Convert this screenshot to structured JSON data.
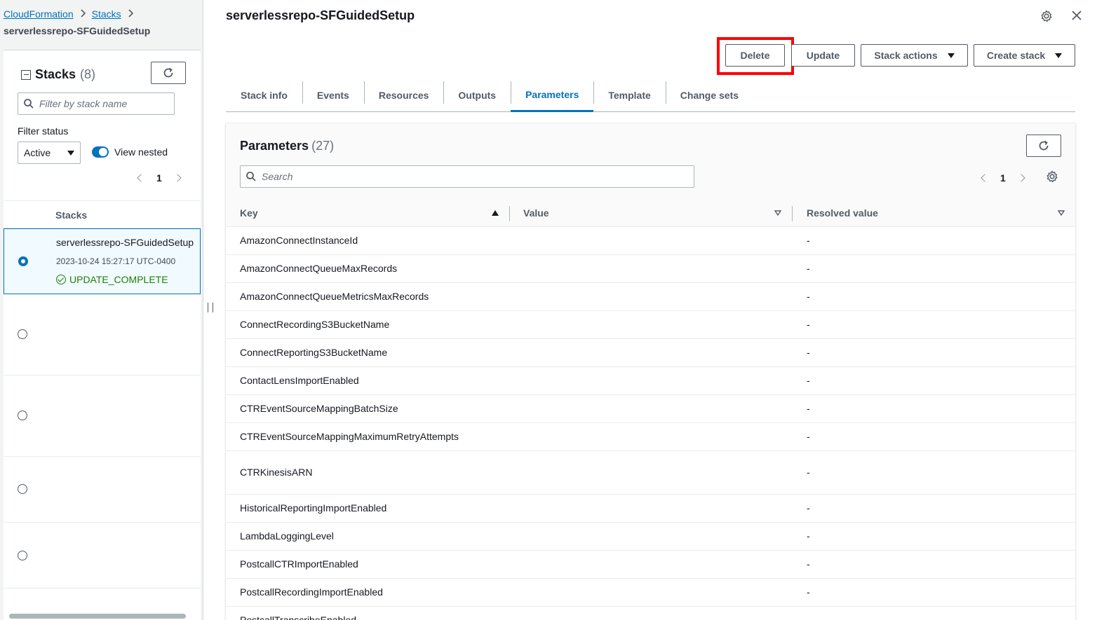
{
  "breadcrumb": {
    "items": [
      "CloudFormation",
      "Stacks"
    ],
    "current": "serverlessrepo-SFGuidedSetup"
  },
  "left_panel": {
    "title": "Stacks",
    "count": "(8)",
    "search_placeholder": "Filter by stack name",
    "filter_status_label": "Filter status",
    "status_value": "Active",
    "view_nested_label": "View nested",
    "view_nested_on": true,
    "page": "1",
    "column_header": "Stacks",
    "selected_stack": {
      "name": "serverlessrepo-SFGuidedSetup",
      "timestamp": "2023-10-24 15:27:17 UTC-0400",
      "status": "UPDATE_COMPLETE"
    }
  },
  "main": {
    "title": "serverlessrepo-SFGuidedSetup",
    "buttons": {
      "delete": "Delete",
      "update": "Update",
      "stack_actions": "Stack actions",
      "create_stack": "Create stack"
    },
    "tabs": [
      "Stack info",
      "Events",
      "Resources",
      "Outputs",
      "Parameters",
      "Template",
      "Change sets"
    ],
    "active_tab": "Parameters",
    "parameters": {
      "title": "Parameters",
      "count": "(27)",
      "search_placeholder": "Search",
      "page": "1",
      "columns": [
        "Key",
        "Value",
        "Resolved value"
      ],
      "rows": [
        {
          "key": "AmazonConnectInstanceId",
          "resolved": "-"
        },
        {
          "key": "AmazonConnectQueueMaxRecords",
          "resolved": "-"
        },
        {
          "key": "AmazonConnectQueueMetricsMaxRecords",
          "resolved": "-"
        },
        {
          "key": "ConnectRecordingS3BucketName",
          "resolved": "-"
        },
        {
          "key": "ConnectReportingS3BucketName",
          "resolved": "-"
        },
        {
          "key": "ContactLensImportEnabled",
          "resolved": "-"
        },
        {
          "key": "CTREventSourceMappingBatchSize",
          "resolved": "-"
        },
        {
          "key": "CTREventSourceMappingMaximumRetryAttempts",
          "resolved": "-"
        },
        {
          "key": "CTRKinesisARN",
          "resolved": "-"
        },
        {
          "key": "HistoricalReportingImportEnabled",
          "resolved": "-"
        },
        {
          "key": "LambdaLoggingLevel",
          "resolved": "-"
        },
        {
          "key": "PostcallCTRImportEnabled",
          "resolved": "-"
        },
        {
          "key": "PostcallRecordingImportEnabled",
          "resolved": "-"
        },
        {
          "key": "PostcallTranscribeEnabled",
          "resolved": "-"
        }
      ]
    }
  },
  "colors": {
    "link": "#0073bb",
    "success": "#1d8102",
    "highlight": "#ff0000"
  }
}
